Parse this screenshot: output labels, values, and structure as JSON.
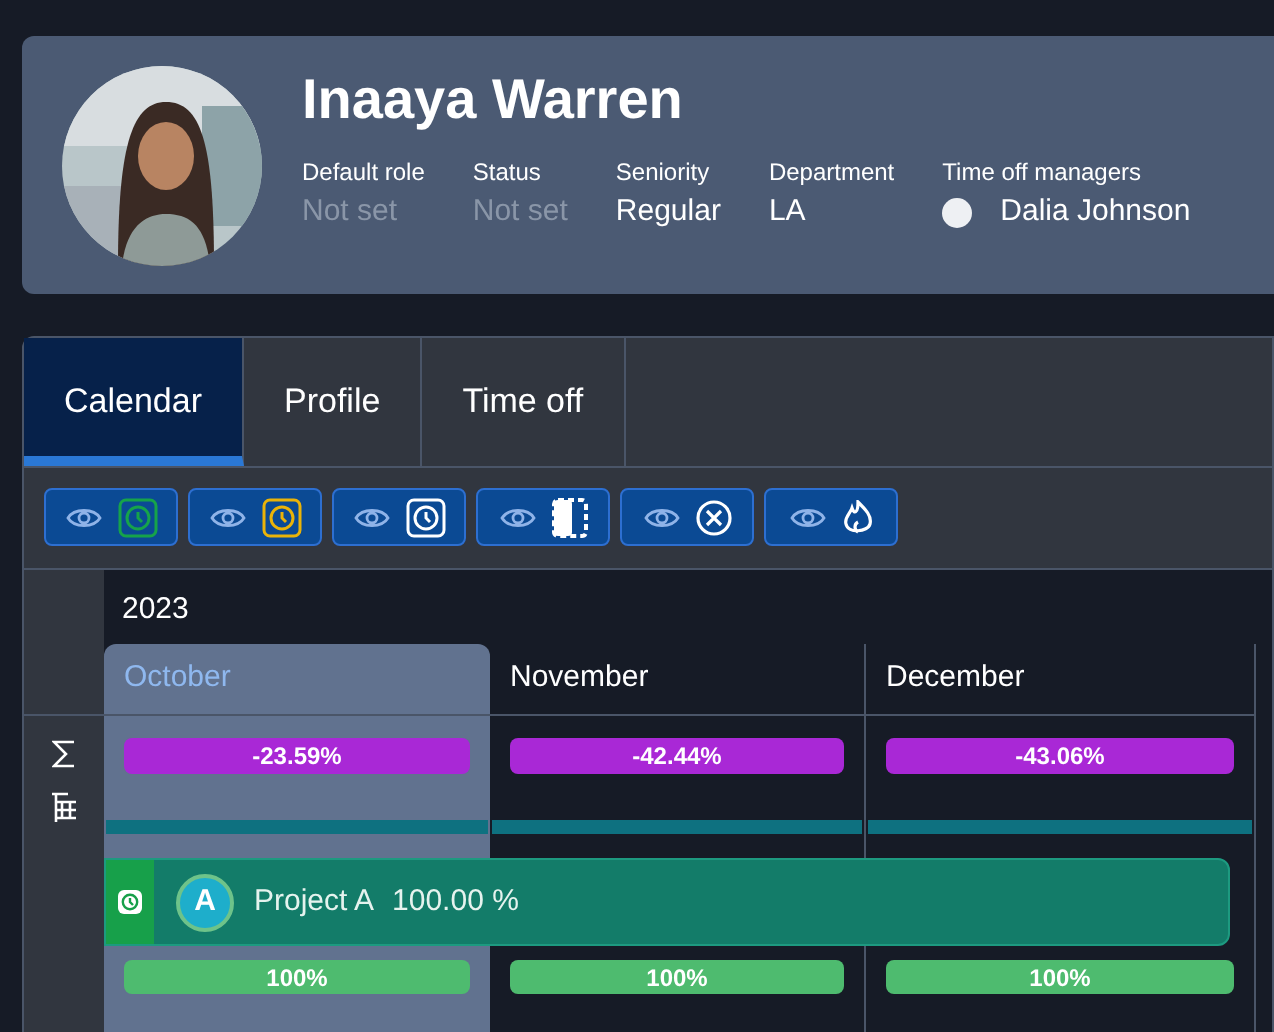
{
  "profile": {
    "name": "Inaaya Warren",
    "fields": [
      {
        "label": "Default role",
        "value": "Not set",
        "set": false,
        "kind": "text"
      },
      {
        "label": "Status",
        "value": "Not set",
        "set": false,
        "kind": "text"
      },
      {
        "label": "Seniority",
        "value": "Regular",
        "set": true,
        "kind": "text"
      },
      {
        "label": "Department",
        "value": "LA",
        "set": true,
        "kind": "text"
      },
      {
        "label": "Time off managers",
        "value": "Dalia Johnson",
        "set": true,
        "kind": "person"
      }
    ]
  },
  "tabs": [
    {
      "label": "Calendar",
      "selected": true
    },
    {
      "label": "Profile",
      "selected": false
    },
    {
      "label": "Time off",
      "selected": false
    }
  ],
  "filters": [
    {
      "kind": "clock",
      "color": "#16a34a"
    },
    {
      "kind": "clock",
      "color": "#eab308"
    },
    {
      "kind": "clock",
      "color": "#ffffff"
    },
    {
      "kind": "half-box"
    },
    {
      "kind": "cancel"
    },
    {
      "kind": "flame"
    }
  ],
  "calendar": {
    "year": "2023",
    "months": [
      {
        "name": "October",
        "selected": true,
        "balance": "-23.59%",
        "allocation": "100%"
      },
      {
        "name": "November",
        "selected": false,
        "balance": "-42.44%",
        "allocation": "100%"
      },
      {
        "name": "December",
        "selected": false,
        "balance": "-43.06%",
        "allocation": "100%"
      }
    ],
    "project": {
      "avatar": "A",
      "name": "Project A",
      "percent": "100.00 %"
    }
  }
}
